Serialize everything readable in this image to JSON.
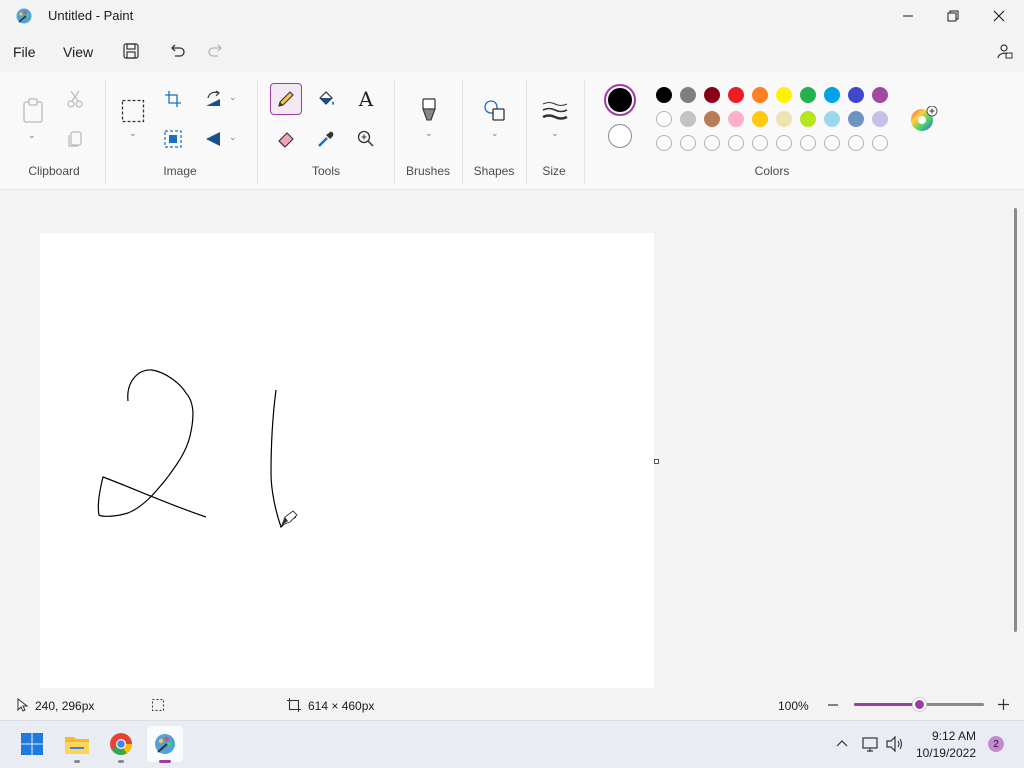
{
  "window": {
    "title": "Untitled - Paint",
    "controls": [
      "minimize",
      "maximize",
      "close"
    ]
  },
  "menu": {
    "file": "File",
    "view": "View"
  },
  "ribbon": {
    "groups": {
      "clipboard": "Clipboard",
      "image": "Image",
      "tools": "Tools",
      "brushes": "Brushes",
      "shapes": "Shapes",
      "size": "Size",
      "colors": "Colors"
    },
    "active_tool": "pencil",
    "text_tool_glyph": "A",
    "primary_color": "#000000",
    "secondary_color": "#ffffff",
    "palette_row1": [
      "#000000",
      "#7f7f7f",
      "#880015",
      "#ed1c24",
      "#ff7f27",
      "#fff200",
      "#22b14c",
      "#00a2e8",
      "#3f48cc",
      "#a349a4"
    ],
    "palette_row2": [
      "#ffffff",
      "#c3c3c3",
      "#b97a57",
      "#ffaec9",
      "#ffc90e",
      "#efe4b0",
      "#b5e61d",
      "#99d9ea",
      "#7092be",
      "#c8bfe7"
    ],
    "palette_row3_count": 10
  },
  "canvas": {
    "background": "#ffffff",
    "drawing": "handwritten 21"
  },
  "status": {
    "cursor_position": "240, 296px",
    "canvas_size": "614 × 460px",
    "zoom": "100%",
    "zoom_level": 0.5
  },
  "taskbar": {
    "apps": [
      "start",
      "file-explorer",
      "chrome",
      "paint"
    ],
    "time": "9:12 AM",
    "date": "10/19/2022",
    "notification_count": "2"
  },
  "colors": {
    "accent": "#9c3da5",
    "ribbon_bg": "#f9f9f9"
  }
}
